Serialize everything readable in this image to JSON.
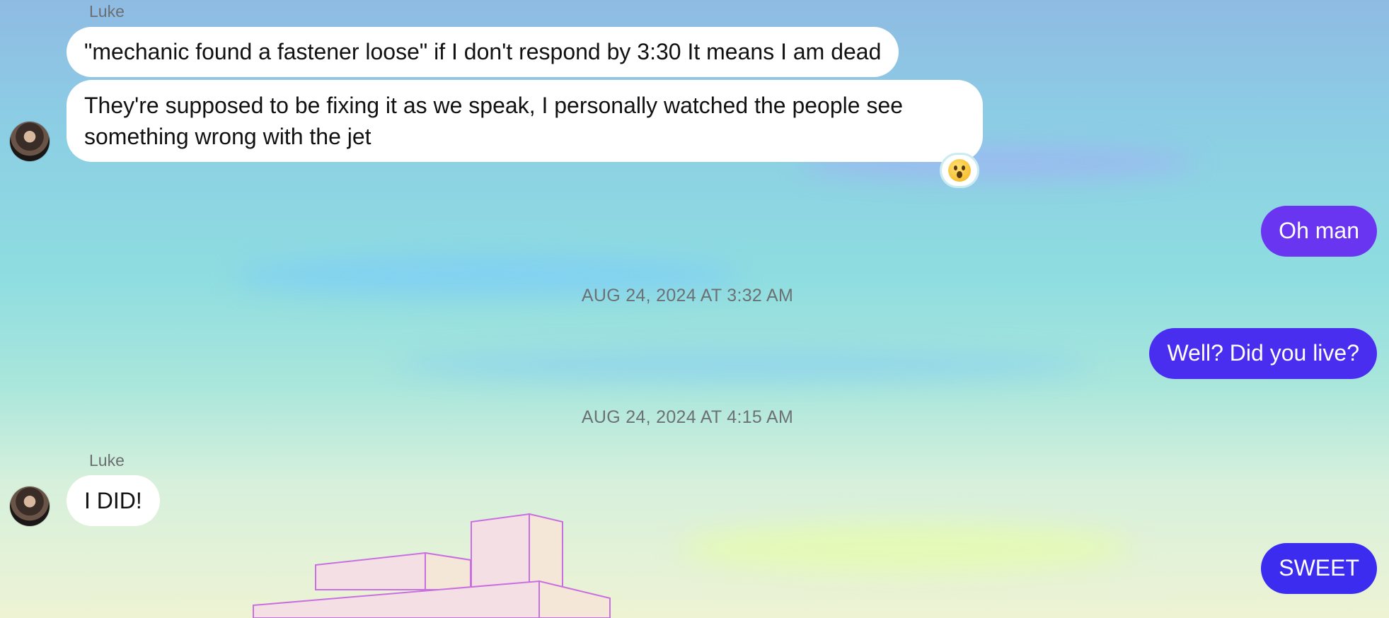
{
  "messages": [
    {
      "sender": "Luke",
      "text": "\"mechanic found a fastener loose\" if I don't respond by 3:30 It means I am dead"
    },
    {
      "text_line1": "They're supposed to be fixing it as we speak, I personally watched the people see",
      "text_line2": "something wrong with the jet",
      "reaction": "astonished-face-emoji"
    },
    {
      "text": "Oh man",
      "color": "#6a35f0"
    },
    {
      "timestamp": "AUG 24, 2024 AT 3:32 AM"
    },
    {
      "text": "Well? Did you live?",
      "color": "#4a2ef0"
    },
    {
      "timestamp": "AUG 24, 2024 AT 4:15 AM"
    },
    {
      "sender": "Luke",
      "text": "I DID!"
    },
    {
      "text": "SWEET",
      "color": "#3b2cf0"
    }
  ]
}
